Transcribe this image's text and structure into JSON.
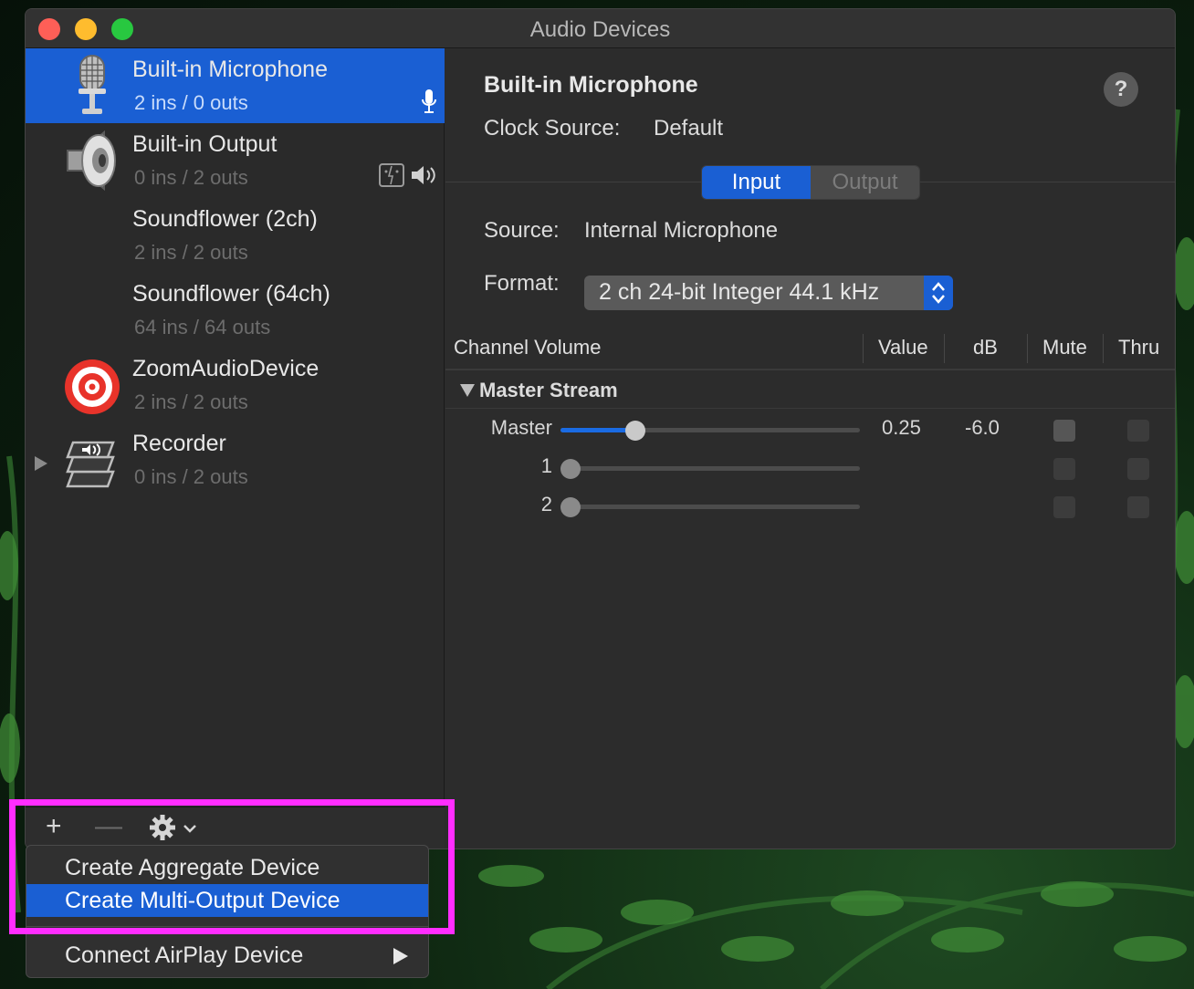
{
  "window": {
    "title": "Audio Devices"
  },
  "sidebar": {
    "devices": [
      {
        "name": "Built-in Microphone",
        "io": "2 ins / 0 outs",
        "icon": "microphone-icon",
        "selected": true,
        "badges": [
          "mic-default-icon"
        ]
      },
      {
        "name": "Built-in Output",
        "io": "0 ins / 2 outs",
        "icon": "speaker-icon",
        "badges": [
          "finder-icon",
          "speaker-default-icon"
        ]
      },
      {
        "name": "Soundflower (2ch)",
        "io": "2 ins / 2 outs"
      },
      {
        "name": "Soundflower (64ch)",
        "io": "64 ins / 64 outs"
      },
      {
        "name": "ZoomAudioDevice",
        "io": "2 ins / 2 outs",
        "icon": "zoom-target-icon"
      },
      {
        "name": "Recorder",
        "io": "0 ins / 2 outs",
        "icon": "recorder-stack-icon",
        "expandable": true
      }
    ],
    "toolbar": {
      "add": "+",
      "remove": "—",
      "gear": "gear-icon"
    }
  },
  "detail": {
    "device_name": "Built-in Microphone",
    "help": "?",
    "clock_label": "Clock Source:",
    "clock_value": "Default",
    "tabs": {
      "input": "Input",
      "output": "Output",
      "active": "Input"
    },
    "source_label": "Source:",
    "source_value": "Internal Microphone",
    "format_label": "Format:",
    "format_value": "2 ch 24-bit Integer 44.1 kHz",
    "table": {
      "headers": {
        "channel": "Channel Volume",
        "value": "Value",
        "db": "dB",
        "mute": "Mute",
        "thru": "Thru"
      },
      "stream": "Master Stream",
      "rows": [
        {
          "name": "Master",
          "level": 0.25,
          "value": "0.25",
          "db": "-6.0",
          "active": true
        },
        {
          "name": "1",
          "level": 0,
          "value": "",
          "db": "",
          "active": false
        },
        {
          "name": "2",
          "level": 0,
          "value": "",
          "db": "",
          "active": false
        }
      ]
    }
  },
  "menu": {
    "items": [
      {
        "label": "Create Aggregate Device",
        "highlighted": false
      },
      {
        "label": "Create Multi-Output Device",
        "highlighted": true
      },
      {
        "label": "Connect AirPlay Device",
        "submenu": true
      }
    ]
  },
  "colors": {
    "accent": "#1a5fd3",
    "annotation": "#ff2dff"
  }
}
